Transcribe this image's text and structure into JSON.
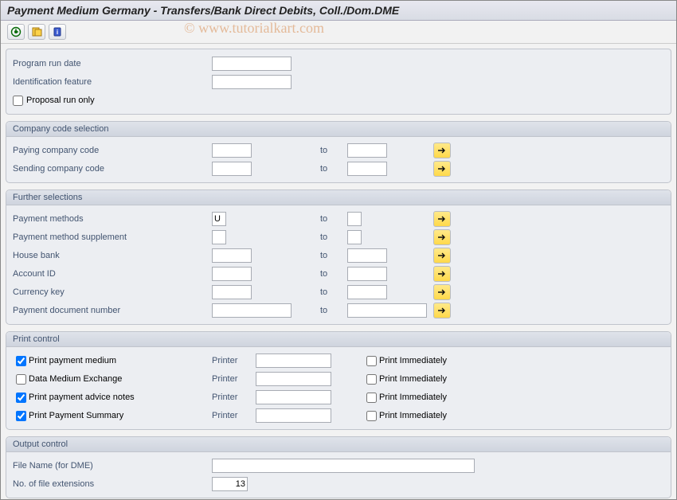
{
  "title": "Payment Medium Germany - Transfers/Bank Direct Debits, Coll./Dom.DME",
  "watermark": "© www.tutorialkart.com",
  "top_fields": {
    "program_run_date": {
      "label": "Program run date",
      "value": ""
    },
    "identification_feature": {
      "label": "Identification feature",
      "value": ""
    },
    "proposal_run_only": {
      "label": "Proposal run only",
      "checked": false
    }
  },
  "company_code_selection": {
    "title": "Company code selection",
    "to_label": "to",
    "rows": [
      {
        "label": "Paying company code",
        "from": "",
        "to": ""
      },
      {
        "label": "Sending company code",
        "from": "",
        "to": ""
      }
    ]
  },
  "further_selections": {
    "title": "Further selections",
    "to_label": "to",
    "rows": [
      {
        "label": "Payment methods",
        "from": "U",
        "to": "",
        "size": "tiny"
      },
      {
        "label": "Payment method supplement",
        "from": "",
        "to": "",
        "size": "tiny"
      },
      {
        "label": "House bank",
        "from": "",
        "to": "",
        "size": "short"
      },
      {
        "label": "Account ID",
        "from": "",
        "to": "",
        "size": "short"
      },
      {
        "label": "Currency key",
        "from": "",
        "to": "",
        "size": "short"
      },
      {
        "label": "Payment document number",
        "from": "",
        "to": "",
        "size": "med"
      }
    ]
  },
  "print_control": {
    "title": "Print control",
    "printer_label": "Printer",
    "print_immediately_label": "Print Immediately",
    "rows": [
      {
        "label": "Print payment medium",
        "checked": true,
        "printer": "",
        "immediately": false
      },
      {
        "label": "Data Medium Exchange",
        "checked": false,
        "printer": "",
        "immediately": false
      },
      {
        "label": "Print payment advice notes",
        "checked": true,
        "printer": "",
        "immediately": false
      },
      {
        "label": "Print Payment Summary",
        "checked": true,
        "printer": "",
        "immediately": false
      }
    ]
  },
  "output_control": {
    "title": "Output control",
    "file_name": {
      "label": "File Name (for DME)",
      "value": ""
    },
    "no_of_file_extensions": {
      "label": "No. of file extensions",
      "value": "13"
    }
  }
}
